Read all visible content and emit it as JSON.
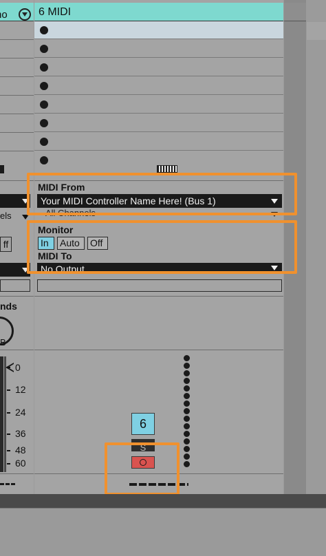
{
  "left_column": {
    "header_label": "no",
    "levels": [
      "0",
      "12",
      "24",
      "36",
      "48",
      "60"
    ],
    "sends_label": "nds",
    "knob_value": "B",
    "dropdown_a": "els",
    "toggle_label": "ff"
  },
  "track": {
    "title": "6 MIDI",
    "midi_from_label": "MIDI From",
    "midi_from_value": "Your MIDI Controller Name Here! (Bus 1)",
    "channel_value": "All Channels",
    "monitor_label": "Monitor",
    "monitor_options": [
      "In",
      "Auto",
      "Off"
    ],
    "midi_to_label": "MIDI To",
    "midi_to_value": "No Output",
    "track_number": "6",
    "solo_label": "S"
  },
  "colors": {
    "accent": "#7ed9cf",
    "highlight": "#f0912e",
    "monitor_active": "#7fd0e3",
    "arm_button": "#d9534f"
  }
}
